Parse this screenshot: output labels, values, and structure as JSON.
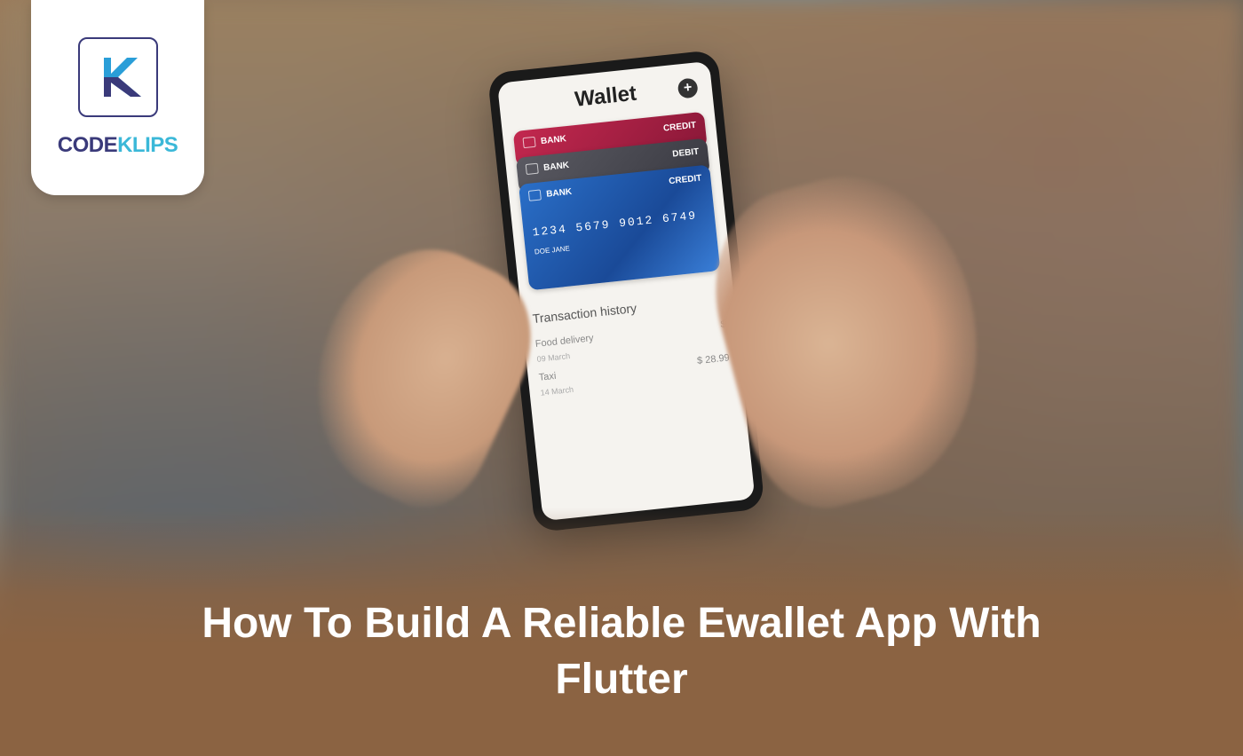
{
  "logo": {
    "code_part": "CODE",
    "klips_part": "KLIPS"
  },
  "phone": {
    "wallet_title": "Wallet",
    "add_icon": "plus-icon",
    "cards": [
      {
        "bank": "BANK",
        "type": "CREDIT"
      },
      {
        "bank": "BANK",
        "type": "DEBIT"
      },
      {
        "bank": "BANK",
        "type": "CREDIT",
        "number": "1234  5679  9012  6749",
        "footer": "DOE JANE"
      }
    ],
    "transaction_title": "Transaction history",
    "transactions": [
      {
        "label": "Food delivery",
        "sub": "09 March",
        "amount": "$"
      },
      {
        "label": "Taxi",
        "sub": "14 March",
        "amount": "$ 28.99"
      }
    ]
  },
  "title": "How To Build A Reliable Ewallet App With Flutter"
}
